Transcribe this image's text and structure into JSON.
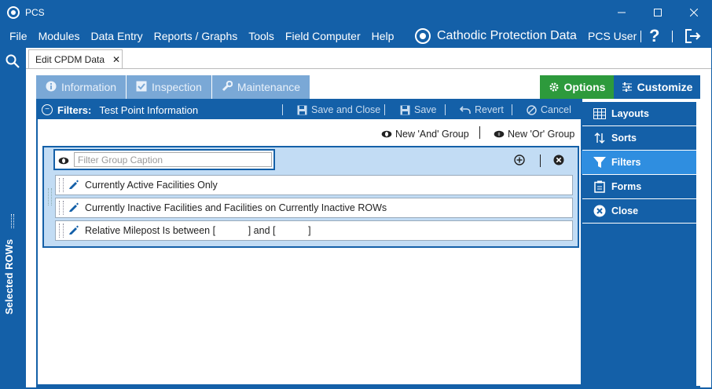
{
  "window": {
    "title": "PCS"
  },
  "menu": {
    "items": [
      "File",
      "Modules",
      "Data Entry",
      "Reports / Graphs",
      "Tools",
      "Field Computer",
      "Help"
    ],
    "brand": "Cathodic Protection Data",
    "user": "PCS User",
    "help": "?"
  },
  "left_rail": {
    "label": "Selected ROWs"
  },
  "doc_tab": {
    "label": "Edit CPDM Data",
    "close": "✕"
  },
  "top_tabs": [
    "Information",
    "Inspection",
    "Maintenance"
  ],
  "options_label": "Options",
  "customize_label": "Customize",
  "filter_bar": {
    "title": "Filters:",
    "subtitle": "Test Point Information",
    "save_close": "Save and Close",
    "save": "Save",
    "revert": "Revert",
    "cancel": "Cancel"
  },
  "new_groups": {
    "and": "New 'And' Group",
    "or": "New 'Or' Group"
  },
  "group": {
    "caption_placeholder": "Filter Group Caption",
    "rows": [
      "Currently Active Facilities Only",
      "Currently Inactive Facilities and Facilities on Currently Inactive ROWs",
      "Relative Milepost Is between [            ] and [            ]"
    ]
  },
  "right_menu": {
    "items": [
      "Layouts",
      "Sorts",
      "Filters",
      "Forms",
      "Close"
    ],
    "active": "Filters"
  },
  "colors": {
    "primary": "#1460a8",
    "accent_green": "#2d9a3c",
    "active_item": "#2f8ee0",
    "group_bg": "#c2dcf4",
    "inactive_tab": "#7aa8d6"
  }
}
